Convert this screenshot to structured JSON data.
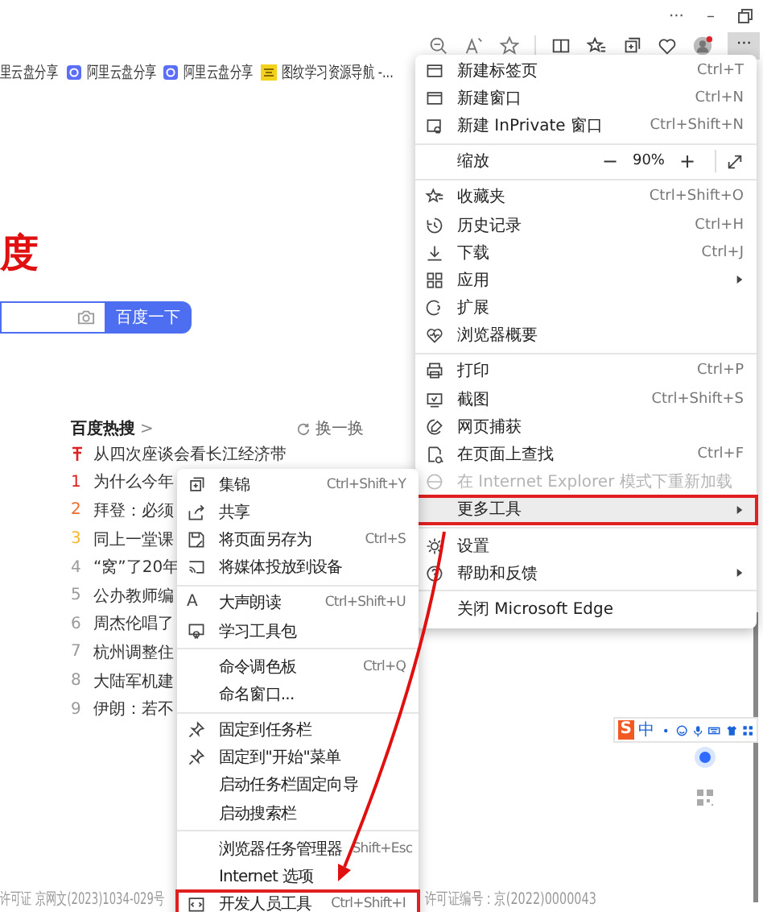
{
  "title_bar": {
    "more": "···",
    "minimize": "–"
  },
  "bookmarks": [
    {
      "kind": "plain",
      "label": "里云盘分享"
    },
    {
      "kind": "cloud",
      "label": "阿里云盘分享"
    },
    {
      "kind": "cloud",
      "label": "阿里云盘分享"
    },
    {
      "kind": "study",
      "label": "图纹学习资源导航 -..."
    }
  ],
  "page": {
    "logo_fragment": "度",
    "search_button": "百度一下",
    "hot": {
      "title": "百度热搜",
      "more": ">",
      "refresh": "换一换",
      "items": [
        {
          "pinned": true,
          "color": "#e02020",
          "text": "从四次座谈会看长江经济带"
        },
        {
          "rank": "1",
          "pinned": false,
          "color": "#e02020",
          "text": "为什么今年"
        },
        {
          "rank": "2",
          "pinned": false,
          "color": "#f06a2a",
          "text": "拜登：必须"
        },
        {
          "rank": "3",
          "pinned": false,
          "color": "#f5b52e",
          "text": "同上一堂课"
        },
        {
          "rank": "4",
          "pinned": false,
          "color": "#9a9a9a",
          "text": "“窝”了20年"
        },
        {
          "rank": "5",
          "pinned": false,
          "color": "#9a9a9a",
          "text": "公办教师编"
        },
        {
          "rank": "6",
          "pinned": false,
          "color": "#9a9a9a",
          "text": "周杰伦唱了"
        },
        {
          "rank": "7",
          "pinned": false,
          "color": "#9a9a9a",
          "text": "杭州调整住"
        },
        {
          "rank": "8",
          "pinned": false,
          "color": "#9a9a9a",
          "text": "大陆军机建"
        },
        {
          "rank": "9",
          "pinned": false,
          "color": "#9a9a9a",
          "text": "伊朗：若不"
        }
      ]
    },
    "footer_left": "许可证 京网文(2023)1034-029号",
    "footer_right": "许可证编号：京(2022)0000043"
  },
  "ime": {
    "logo": "S",
    "mode": "中"
  },
  "menu": {
    "items": [
      {
        "kind": "item",
        "label": "新建标签页",
        "shortcut": "Ctrl+T"
      },
      {
        "kind": "item",
        "label": "新建窗口",
        "shortcut": "Ctrl+N"
      },
      {
        "kind": "item",
        "label": "新建 InPrivate 窗口",
        "shortcut": "Ctrl+Shift+N"
      },
      {
        "kind": "separator"
      },
      {
        "kind": "zoom",
        "label": "缩放",
        "minus": "−",
        "value": "90%",
        "plus": "+"
      },
      {
        "kind": "separator"
      },
      {
        "kind": "item",
        "label": "收藏夹",
        "shortcut": "Ctrl+Shift+O"
      },
      {
        "kind": "item",
        "label": "历史记录",
        "shortcut": "Ctrl+H"
      },
      {
        "kind": "item",
        "label": "下载",
        "shortcut": "Ctrl+J"
      },
      {
        "kind": "item",
        "label": "应用",
        "submenu": true
      },
      {
        "kind": "item",
        "label": "扩展"
      },
      {
        "kind": "item",
        "label": "浏览器概要"
      },
      {
        "kind": "separator"
      },
      {
        "kind": "item",
        "label": "打印",
        "shortcut": "Ctrl+P"
      },
      {
        "kind": "item",
        "label": "截图",
        "shortcut": "Ctrl+Shift+S"
      },
      {
        "kind": "item",
        "label": "网页捕获"
      },
      {
        "kind": "item",
        "label": "在页面上查找",
        "shortcut": "Ctrl+F"
      },
      {
        "kind": "item",
        "label": "在 Internet Explorer 模式下重新加载",
        "disabled": true
      },
      {
        "kind": "item",
        "label": "更多工具",
        "submenu": true,
        "selected": true,
        "highlighted": true
      },
      {
        "kind": "separator"
      },
      {
        "kind": "item",
        "label": "设置"
      },
      {
        "kind": "item",
        "label": "帮助和反馈",
        "submenu": true
      },
      {
        "kind": "separator"
      },
      {
        "kind": "item",
        "label": "关闭 Microsoft Edge"
      }
    ]
  },
  "submenu": {
    "items": [
      {
        "kind": "item",
        "label": "集锦",
        "shortcut": "Ctrl+Shift+Y"
      },
      {
        "kind": "item",
        "label": "共享"
      },
      {
        "kind": "item",
        "label": "将页面另存为",
        "shortcut": "Ctrl+S"
      },
      {
        "kind": "item",
        "label": "将媒体投放到设备"
      },
      {
        "kind": "separator"
      },
      {
        "kind": "item",
        "label": "大声朗读",
        "shortcut": "Ctrl+Shift+U",
        "glyph": "A"
      },
      {
        "kind": "item",
        "label": "学习工具包"
      },
      {
        "kind": "separator"
      },
      {
        "kind": "item",
        "label": "命令调色板",
        "shortcut": "Ctrl+Q"
      },
      {
        "kind": "item",
        "label": "命名窗口..."
      },
      {
        "kind": "separator"
      },
      {
        "kind": "item",
        "label": "固定到任务栏"
      },
      {
        "kind": "item",
        "label": "固定到\"开始\"菜单"
      },
      {
        "kind": "item",
        "label": "启动任务栏固定向导"
      },
      {
        "kind": "item",
        "label": "启动搜索栏"
      },
      {
        "kind": "separator"
      },
      {
        "kind": "item",
        "label": "浏览器任务管理器",
        "shortcut": "Shift+Esc"
      },
      {
        "kind": "item",
        "label": "Internet 选项"
      },
      {
        "kind": "item",
        "label": "开发人员工具",
        "shortcut": "Ctrl+Shift+I",
        "highlighted": true
      }
    ]
  }
}
